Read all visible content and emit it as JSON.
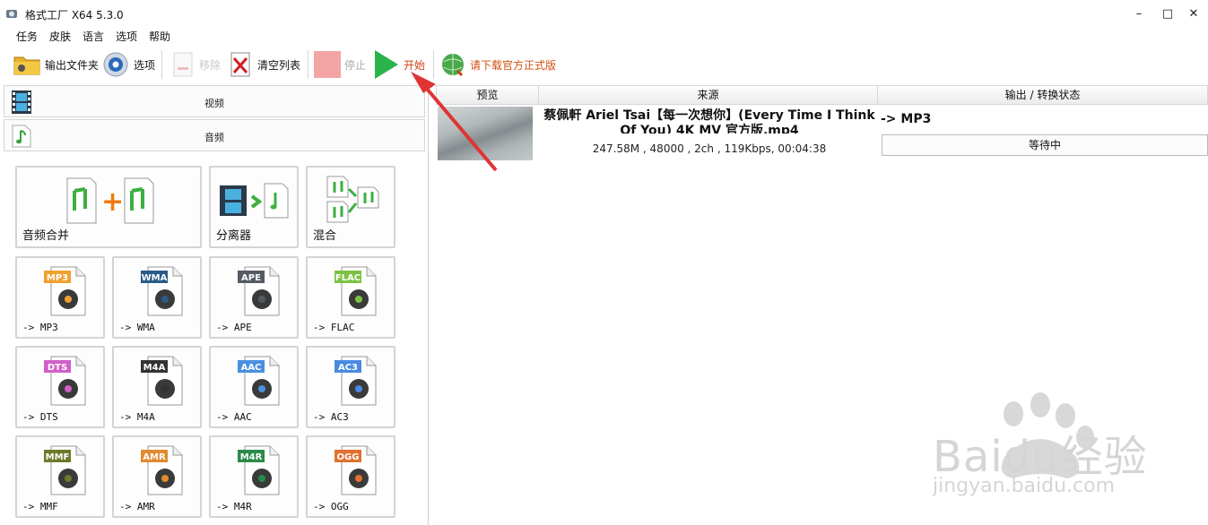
{
  "window": {
    "title": "格式工厂 X64 5.3.0",
    "minimize": "–",
    "maximize": "□",
    "close": "✕"
  },
  "menu": [
    "任务",
    "皮肤",
    "语言",
    "选项",
    "帮助"
  ],
  "toolbar": {
    "output_folder": "输出文件夹",
    "options": "选项",
    "remove": "移除",
    "clear_list": "清空列表",
    "stop": "停止",
    "start": "开始",
    "download": "请下载官方正式版"
  },
  "categories": {
    "video": "视频",
    "audio": "音频"
  },
  "tiles": {
    "merge": "音频合并",
    "splitter": "分离器",
    "mix": "混合",
    "formats": [
      {
        "badge": "MP3",
        "caption": "-> MP3",
        "badge_color": "#f0a030"
      },
      {
        "badge": "WMA",
        "caption": "-> WMA",
        "badge_color": "#2a5a8a"
      },
      {
        "badge": "APE",
        "caption": "-> APE",
        "badge_color": "#555b63"
      },
      {
        "badge": "FLAC",
        "caption": "-> FLAC",
        "badge_color": "#7cc242"
      },
      {
        "badge": "DTS",
        "caption": "-> DTS",
        "badge_color": "#d060c8"
      },
      {
        "badge": "M4A",
        "caption": "-> M4A",
        "badge_color": "#333333"
      },
      {
        "badge": "AAC",
        "caption": "-> AAC",
        "badge_color": "#4a90e0"
      },
      {
        "badge": "AC3",
        "caption": "-> AC3",
        "badge_color": "#4a8ae0"
      },
      {
        "badge": "MMF",
        "caption": "-> MMF",
        "badge_color": "#6a7a2a"
      },
      {
        "badge": "AMR",
        "caption": "-> AMR",
        "badge_color": "#e08a30"
      },
      {
        "badge": "M4R",
        "caption": "-> M4R",
        "badge_color": "#2a8a4a"
      },
      {
        "badge": "OGG",
        "caption": "-> OGG",
        "badge_color": "#e07030"
      }
    ]
  },
  "task_list": {
    "headers": {
      "preview": "预览",
      "source": "来源",
      "output": "输出 / 转换状态"
    },
    "rows": [
      {
        "title": "蔡佩軒 Ariel Tsai【每一次想你】(Every Time I Think Of You) 4K MV 官方版.mp4",
        "info": "247.58M , 48000 , 2ch , 119Kbps, 00:04:38",
        "output_format": "-> MP3",
        "status": "等待中"
      }
    ]
  },
  "watermark": {
    "brand": "Baidu经验",
    "url": "jingyan.baidu.com"
  },
  "colors": {
    "arrow": "#e03434",
    "start_green": "#2ab34a",
    "stop_red": "#f0a0a0"
  }
}
